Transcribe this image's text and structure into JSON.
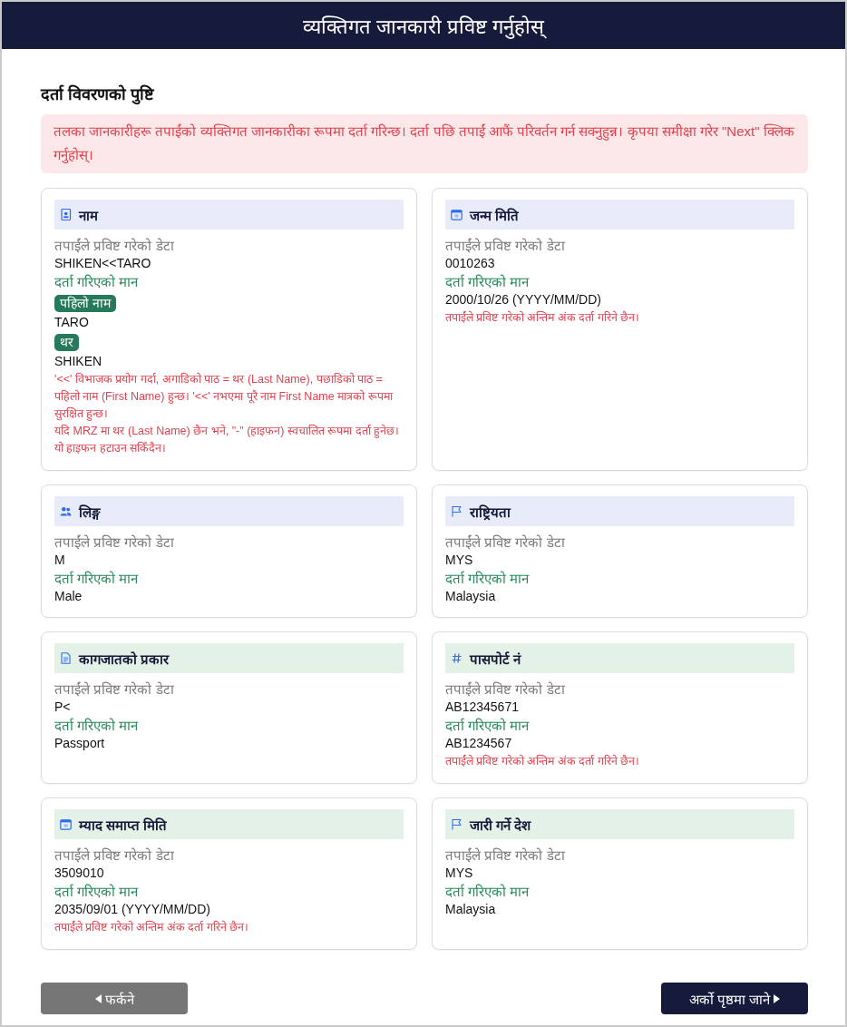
{
  "header": {
    "title": "व्यक्तिगत जानकारी प्रविष्ट गर्नुहोस्"
  },
  "heading": "दर्ता विवरणको पुष्टि",
  "alert": "तलका जानकारीहरू तपाईंको व्यक्तिगत जानकारीका रूपमा दर्ता गरिन्छ। दर्ता पछि तपाईं आफैं परिवर्तन गर्न सक्नुहुन्न। कृपया समीक्षा गरेर \"Next\" क्लिक गर्नुहोस्।",
  "cards": [
    {
      "kind": "name",
      "title": "नाम",
      "color": "#e8ecf8",
      "entered_label": "तपाईंले प्रविष्ट गरेको डेटा",
      "entered_value": "SHIKEN<<TARO",
      "registered_label": "दर्ता गरिएको मान",
      "name_parts": [
        {
          "label": "पहिलो नाम",
          "value": "TARO"
        },
        {
          "label": "थर",
          "value": "SHIKEN"
        }
      ],
      "notes": [
        "'<<' विभाजक प्रयोग गर्दा, अगाडिको पाठ = थर (Last Name), पछाडिको पाठ = पहिलो नाम (First Name) हुन्छ। '<<' नभएमा पूरै नाम First Name मात्रको रूपमा सुरक्षित हुन्छ।",
        "यदि MRZ मा थर (Last Name) छैन भने, \"-\" (हाइफन) स्वचालित रूपमा दर्ता हुनेछ। यो हाइफन हटाउन सकिँदैन।"
      ]
    },
    {
      "kind": "date",
      "title": "जन्म मिति",
      "color": "#e8ecf8",
      "entered_label": "तपाईंले प्रविष्ट गरेको डेटा",
      "entered_value": "0010263",
      "registered_label": "दर्ता गरिएको मान",
      "registered_value": "2000/10/26 (YYYY/MM/DD)",
      "notes": [
        "तपाईंले प्रविष्ट गरेको अन्तिम अंक दर्ता गरिने छैन।"
      ]
    },
    {
      "kind": "gender",
      "title": "लिङ्ग",
      "color": "#e8ecf8",
      "entered_label": "तपाईंले प्रविष्ट गरेको डेटा",
      "entered_value": "M",
      "registered_label": "दर्ता गरिएको मान",
      "registered_value": "Male"
    },
    {
      "kind": "country",
      "title": "राष्ट्रियता",
      "color": "#e8ecf8",
      "entered_label": "तपाईंले प्रविष्ट गरेको डेटा",
      "entered_value": "MYS",
      "registered_label": "दर्ता गरिएको मान",
      "registered_value": "Malaysia"
    },
    {
      "kind": "document",
      "title": "कागजातको प्रकार",
      "color": "#e3f1e6",
      "entered_label": "तपाईंले प्रविष्ट गरेको डेटा",
      "entered_value": "P<",
      "registered_label": "दर्ता गरिएको मान",
      "registered_value": "Passport"
    },
    {
      "kind": "number",
      "title": "पासपोर्ट नं",
      "color": "#e3f1e6",
      "entered_label": "तपाईंले प्रविष्ट गरेको डेटा",
      "entered_value": "AB12345671",
      "registered_label": "दर्ता गरिएको मान",
      "registered_value": "AB1234567",
      "notes": [
        "तपाईंले प्रविष्ट गरेको अन्तिम अंक दर्ता गरिने छैन।"
      ]
    },
    {
      "kind": "date",
      "title": "म्याद समाप्त मिति",
      "color": "#e3f1e6",
      "entered_label": "तपाईंले प्रविष्ट गरेको डेटा",
      "entered_value": "3509010",
      "registered_label": "दर्ता गरिएको मान",
      "registered_value": "2035/09/01 (YYYY/MM/DD)",
      "notes": [
        "तपाईंले प्रविष्ट गरेको अन्तिम अंक दर्ता गरिने छैन।"
      ]
    },
    {
      "kind": "country",
      "title": "जारी गर्ने देश",
      "color": "#e3f1e6",
      "entered_label": "तपाईंले प्रविष्ट गरेको डेटा",
      "entered_value": "MYS",
      "registered_label": "दर्ता गरिएको मान",
      "registered_value": "Malaysia"
    }
  ],
  "buttons": {
    "back": "फर्कने",
    "next": "अर्को पृष्ठमा जाने"
  }
}
